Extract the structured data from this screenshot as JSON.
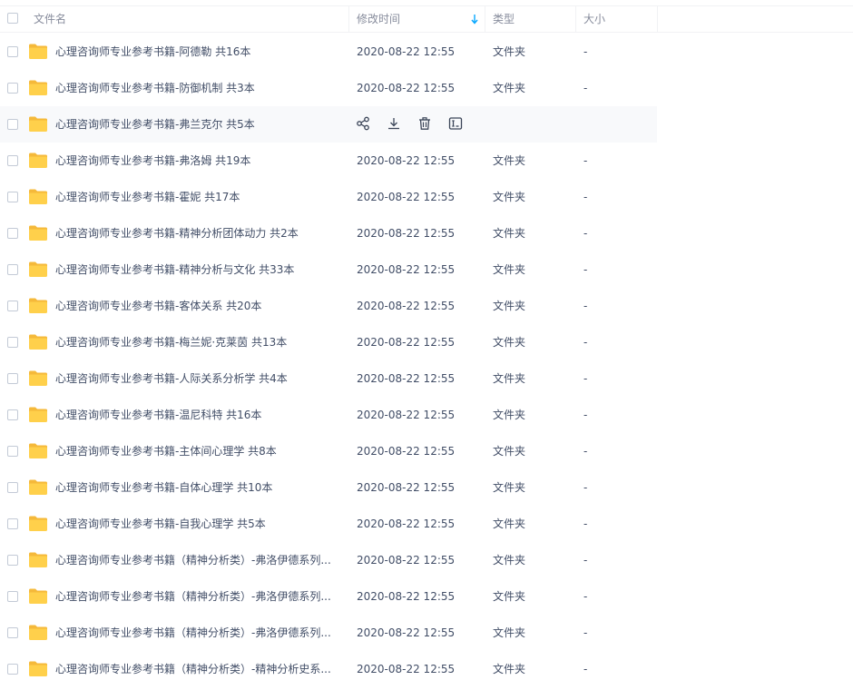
{
  "header": {
    "col_name": "文件名",
    "col_time": "修改时间",
    "col_type": "类型",
    "col_size": "大小"
  },
  "colors": {
    "folder": "#ffd04b",
    "folder_back": "#f5b93a",
    "sort_arrow": "#06a7ff",
    "text": "#424e67",
    "muted": "#878c9c"
  },
  "rows": [
    {
      "name": "心理咨询师专业参考书籍-阿德勒 共16本",
      "time": "2020-08-22 12:55",
      "type": "文件夹",
      "size": "-"
    },
    {
      "name": "心理咨询师专业参考书籍-防御机制 共3本",
      "time": "2020-08-22 12:55",
      "type": "文件夹",
      "size": "-"
    },
    {
      "name": "心理咨询师专业参考书籍-弗兰克尔 共5本",
      "time": "",
      "type": "",
      "size": ""
    },
    {
      "name": "心理咨询师专业参考书籍-弗洛姆 共19本",
      "time": "2020-08-22 12:55",
      "type": "文件夹",
      "size": "-"
    },
    {
      "name": "心理咨询师专业参考书籍-霍妮 共17本",
      "time": "2020-08-22 12:55",
      "type": "文件夹",
      "size": "-"
    },
    {
      "name": "心理咨询师专业参考书籍-精神分析团体动力  共2本",
      "time": "2020-08-22 12:55",
      "type": "文件夹",
      "size": "-"
    },
    {
      "name": "心理咨询师专业参考书籍-精神分析与文化 共33本",
      "time": "2020-08-22 12:55",
      "type": "文件夹",
      "size": "-"
    },
    {
      "name": "心理咨询师专业参考书籍-客体关系 共20本",
      "time": "2020-08-22 12:55",
      "type": "文件夹",
      "size": "-"
    },
    {
      "name": "心理咨询师专业参考书籍-梅兰妮·克莱茵 共13本",
      "time": "2020-08-22 12:55",
      "type": "文件夹",
      "size": "-"
    },
    {
      "name": "心理咨询师专业参考书籍-人际关系分析学 共4本",
      "time": "2020-08-22 12:55",
      "type": "文件夹",
      "size": "-"
    },
    {
      "name": "心理咨询师专业参考书籍-温尼科特 共16本",
      "time": "2020-08-22 12:55",
      "type": "文件夹",
      "size": "-"
    },
    {
      "name": "心理咨询师专业参考书籍-主体间心理学 共8本",
      "time": "2020-08-22 12:55",
      "type": "文件夹",
      "size": "-"
    },
    {
      "name": "心理咨询师专业参考书籍-自体心理学 共10本",
      "time": "2020-08-22 12:55",
      "type": "文件夹",
      "size": "-"
    },
    {
      "name": "心理咨询师专业参考书籍-自我心理学 共5本",
      "time": "2020-08-22 12:55",
      "type": "文件夹",
      "size": "-"
    },
    {
      "name": "心理咨询师专业参考书籍（精神分析类）-弗洛伊德系列...",
      "time": "2020-08-22 12:55",
      "type": "文件夹",
      "size": "-"
    },
    {
      "name": "心理咨询师专业参考书籍（精神分析类）-弗洛伊德系列...",
      "time": "2020-08-22 12:55",
      "type": "文件夹",
      "size": "-"
    },
    {
      "name": "心理咨询师专业参考书籍（精神分析类）-弗洛伊德系列...",
      "time": "2020-08-22 12:55",
      "type": "文件夹",
      "size": "-"
    },
    {
      "name": "心理咨询师专业参考书籍（精神分析类）-精神分析史系...",
      "time": "2020-08-22 12:55",
      "type": "文件夹",
      "size": "-"
    }
  ],
  "hover_actions": [
    {
      "icon": "share-icon"
    },
    {
      "icon": "download-icon"
    },
    {
      "icon": "delete-icon"
    },
    {
      "icon": "rename-icon"
    }
  ]
}
